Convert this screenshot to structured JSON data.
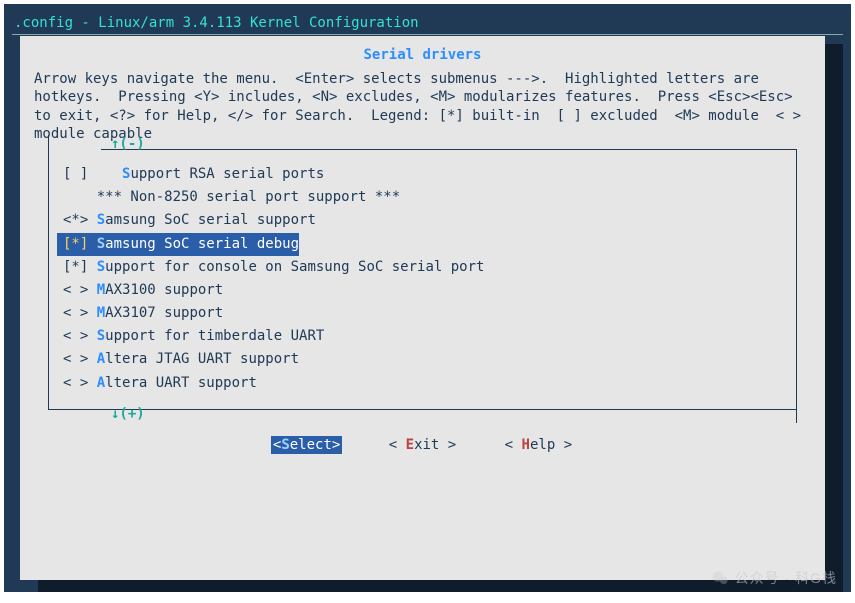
{
  "window": {
    "title": ".config - Linux/arm 3.4.113 Kernel Configuration"
  },
  "menu": {
    "title": "Serial drivers",
    "help": "Arrow keys navigate the menu.  <Enter> selects submenus --->.  Highlighted letters are hotkeys.  Pressing <Y> includes, <N> excludes, <M> modularizes features.  Press <Esc><Esc> to exit, <?> for Help, </> for Search.  Legend: [*] built-in  [ ] excluded  <M> module  < > module capable",
    "scroll_up": "↑(-)",
    "scroll_down": "↓(+)",
    "items": [
      {
        "state": "[ ]",
        "hk": "S",
        "rest": "upport RSA serial ports",
        "selected": false,
        "indent": "   "
      },
      {
        "state": "",
        "hk": "",
        "rest": "*** Non-8250 serial port support ***",
        "selected": false,
        "indent": ""
      },
      {
        "state": "<*>",
        "hk": "S",
        "rest": "amsung SoC serial support",
        "selected": false,
        "indent": ""
      },
      {
        "state": "[*]",
        "hk": "S",
        "rest": "amsung SoC serial debug",
        "selected": true,
        "indent": ""
      },
      {
        "state": "[*]",
        "hk": "S",
        "rest": "upport for console on Samsung SoC serial port",
        "selected": false,
        "indent": ""
      },
      {
        "state": "< >",
        "hk": "M",
        "rest": "AX3100 support",
        "selected": false,
        "indent": ""
      },
      {
        "state": "< >",
        "hk": "M",
        "rest": "AX3107 support",
        "selected": false,
        "indent": ""
      },
      {
        "state": "< >",
        "hk": "S",
        "rest": "upport for timberdale UART",
        "selected": false,
        "indent": ""
      },
      {
        "state": "< >",
        "hk": "A",
        "rest": "ltera JTAG UART support",
        "selected": false,
        "indent": ""
      },
      {
        "state": "< >",
        "hk": "A",
        "rest": "ltera UART support",
        "selected": false,
        "indent": ""
      }
    ]
  },
  "buttons": {
    "select": {
      "open": "<",
      "hk": "S",
      "rest": "elect",
      "close": ">",
      "selected": true
    },
    "exit": {
      "open": "< ",
      "hk": "E",
      "rest": "xit ",
      "close": ">",
      "selected": false
    },
    "help": {
      "open": "< ",
      "hk": "H",
      "rest": "elp ",
      "close": ">",
      "selected": false
    }
  },
  "watermark": "公众号 · 科G栈"
}
